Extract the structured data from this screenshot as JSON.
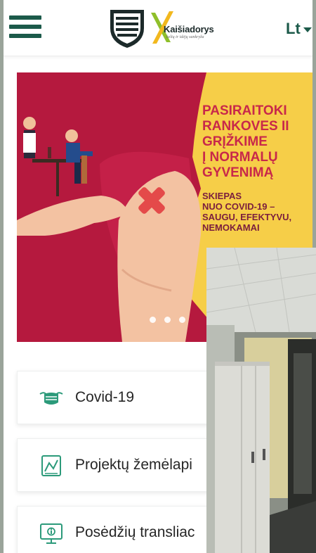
{
  "header": {
    "menu_icon": "hamburger-menu-icon",
    "logo": {
      "name": "Kaišiadorys",
      "tagline": "kelių ir idėjų sankryža"
    },
    "language": "Lt"
  },
  "banner": {
    "headline": "PASIRAITOKI\nRANKOVES II\nGRĮŽKIME\nĮ NORMALŲ\nGYVENIMĄ",
    "subtext": "SKIEPAS\nNUO COVID-19 –\nSAUGU, EFEKTYVU,\nNEMOKAMAI",
    "slides_count": 3,
    "colors": {
      "background": "#f6ce48",
      "shirt": "#b5193e",
      "headline": "#c8284a"
    }
  },
  "quick_links": [
    {
      "label": "Covid-19",
      "icon": "face-mask-icon"
    },
    {
      "label": "Projektų žemėlapi",
      "icon": "map-blueprint-icon"
    },
    {
      "label": "Posėdžių transliac",
      "icon": "monitor-broadcast-icon"
    }
  ],
  "accent_color": "#1c5a4a",
  "icon_color": "#2c9a7a"
}
